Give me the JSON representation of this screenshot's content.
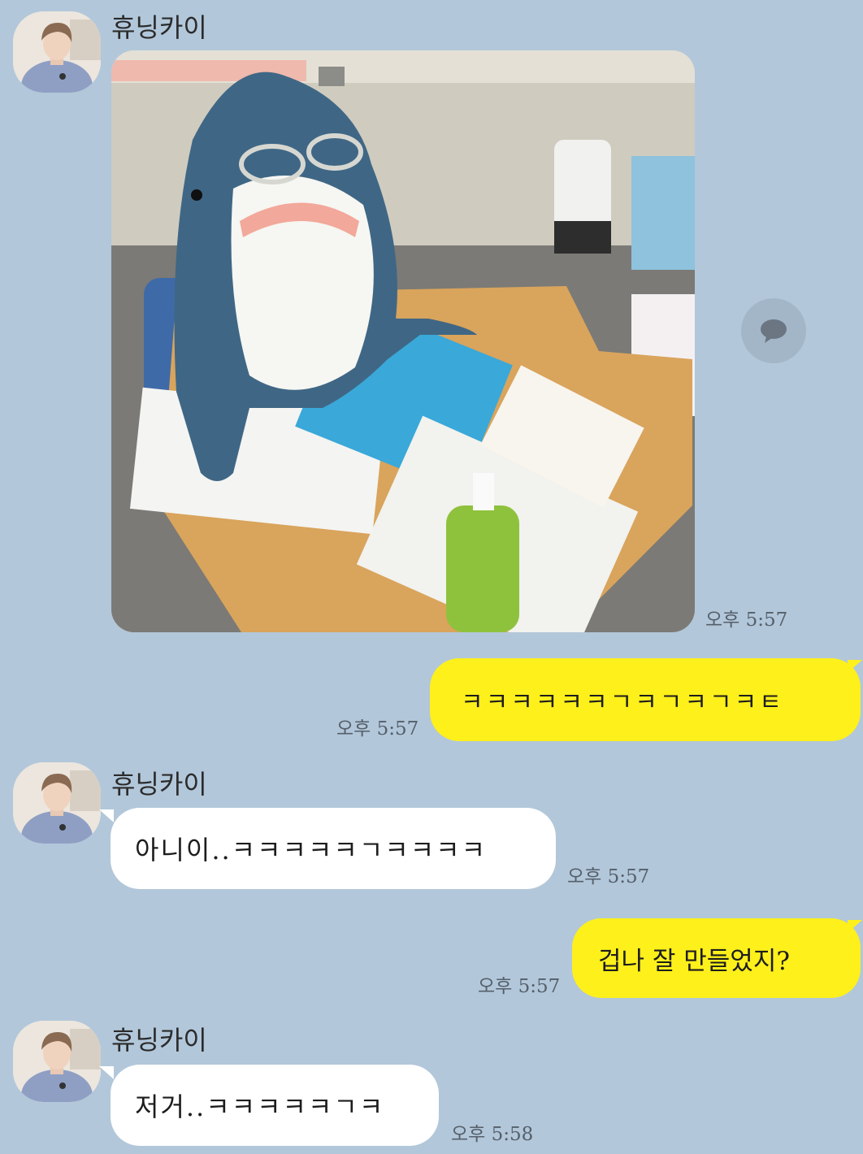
{
  "chat": {
    "colors": {
      "background": "#b2c7da",
      "incoming_bubble": "#ffffff",
      "outgoing_bubble": "#fef01b",
      "timestamp": "#555f6a"
    },
    "share_button": {
      "icon": "speech-bubble-icon"
    },
    "messages": [
      {
        "direction": "incoming",
        "sender": "휴닝카이",
        "type": "photo",
        "photo_subject": "shark plush toy with glasses at a school desk",
        "time": "오후 5:57"
      },
      {
        "direction": "outgoing",
        "type": "text",
        "text": "ㅋㅋㅋㅋㅋㅋㄱㅋㄱㅋㄱㅋㅌ",
        "time": "오후 5:57"
      },
      {
        "direction": "incoming",
        "sender": "휴닝카이",
        "type": "text",
        "text": "아니이..ㅋㅋㅋㅋㅋㄱㅋㅋㅋㅋ",
        "time": "오후 5:57"
      },
      {
        "direction": "outgoing",
        "type": "text",
        "text": "겁나 잘 만들었지?",
        "time": "오후 5:57"
      },
      {
        "direction": "incoming",
        "sender": "휴닝카이",
        "type": "text",
        "text": "저거..ㅋㅋㅋㅋㅋㄱㅋ",
        "time": "오후 5:58"
      }
    ]
  }
}
